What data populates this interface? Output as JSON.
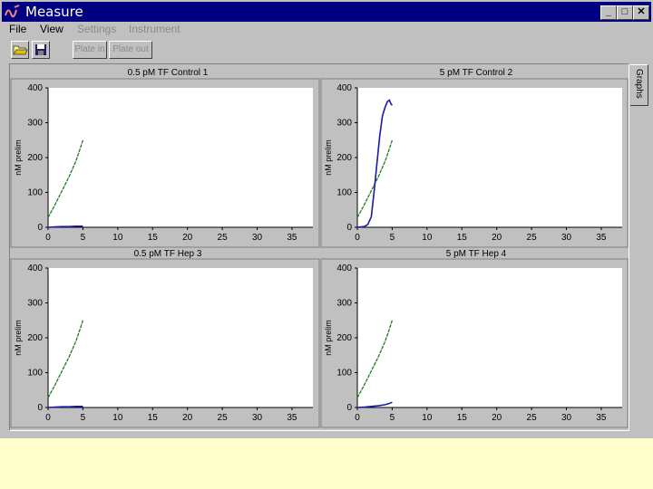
{
  "window": {
    "title": "Measure",
    "title_bar_color": "#000080",
    "controls": [
      {
        "name": "minimize-button",
        "glyph": "_"
      },
      {
        "name": "maximize-button",
        "glyph": "□"
      },
      {
        "name": "close-button",
        "glyph": "✕"
      }
    ]
  },
  "menu": {
    "items": [
      {
        "label": "File",
        "enabled": true
      },
      {
        "label": "View",
        "enabled": true
      },
      {
        "label": "Settings",
        "enabled": false
      },
      {
        "label": "Instrument",
        "enabled": false
      }
    ]
  },
  "toolbar": {
    "open_icon": "folder-open-icon",
    "save_icon": "floppy-save-icon",
    "plate_in_label": "Plate in",
    "plate_out_label": "Plate out"
  },
  "side_tab": {
    "label": "Graphs"
  },
  "colors": {
    "green_series": "#1f7a1f",
    "blue_series": "#1a1aa6",
    "background_slide": "#ffffcc"
  },
  "chart_data": [
    {
      "type": "line",
      "title": "0.5 pM TF Control 1",
      "ylabel": "nM prelim",
      "xlim": [
        0,
        38
      ],
      "ylim": [
        0,
        400
      ],
      "xticks": [
        0,
        5,
        10,
        15,
        20,
        25,
        30,
        35
      ],
      "yticks": [
        0,
        100,
        200,
        300,
        400
      ],
      "series": [
        {
          "color": "#1f7a1f",
          "x": [
            0,
            1,
            2,
            3,
            4,
            4.6,
            5
          ],
          "y": [
            28,
            65,
            105,
            145,
            190,
            225,
            250
          ]
        },
        {
          "color": "#1a1aa6",
          "x": [
            0,
            1,
            2,
            3,
            4,
            5
          ],
          "y": [
            0,
            1,
            2,
            2,
            3,
            3
          ]
        }
      ]
    },
    {
      "type": "line",
      "title": "5 pM TF Control 2",
      "ylabel": "nM prelim",
      "xlim": [
        0,
        38
      ],
      "ylim": [
        0,
        400
      ],
      "xticks": [
        0,
        5,
        10,
        15,
        20,
        25,
        30,
        35
      ],
      "yticks": [
        0,
        100,
        200,
        300,
        400
      ],
      "series": [
        {
          "color": "#1f7a1f",
          "x": [
            0,
            1,
            2,
            3,
            4,
            4.6,
            5
          ],
          "y": [
            28,
            65,
            105,
            145,
            190,
            225,
            250
          ]
        },
        {
          "color": "#1a1aa6",
          "x": [
            0,
            1,
            1.5,
            2,
            2.4,
            2.8,
            3.2,
            3.6,
            4,
            4.3,
            4.6,
            4.8,
            5
          ],
          "y": [
            0,
            2,
            8,
            30,
            100,
            180,
            260,
            320,
            345,
            360,
            365,
            355,
            350
          ]
        }
      ]
    },
    {
      "type": "line",
      "title": "0.5 pM TF Hep 3",
      "ylabel": "nM prelim",
      "xlim": [
        0,
        38
      ],
      "ylim": [
        0,
        400
      ],
      "xticks": [
        0,
        5,
        10,
        15,
        20,
        25,
        30,
        35
      ],
      "yticks": [
        0,
        100,
        200,
        300,
        400
      ],
      "series": [
        {
          "color": "#1f7a1f",
          "x": [
            0,
            1,
            2,
            3,
            4,
            4.6,
            5
          ],
          "y": [
            28,
            65,
            105,
            145,
            190,
            225,
            250
          ]
        },
        {
          "color": "#1a1aa6",
          "x": [
            0,
            1,
            2,
            3,
            4,
            5
          ],
          "y": [
            0,
            1,
            2,
            2,
            3,
            3
          ]
        }
      ]
    },
    {
      "type": "line",
      "title": "5 pM TF Hep 4",
      "ylabel": "nM prelim",
      "xlim": [
        0,
        38
      ],
      "ylim": [
        0,
        400
      ],
      "xticks": [
        0,
        5,
        10,
        15,
        20,
        25,
        30,
        35
      ],
      "yticks": [
        0,
        100,
        200,
        300,
        400
      ],
      "series": [
        {
          "color": "#1f7a1f",
          "x": [
            0,
            1,
            2,
            3,
            4,
            4.6,
            5
          ],
          "y": [
            28,
            65,
            105,
            145,
            190,
            225,
            250
          ]
        },
        {
          "color": "#1a1aa6",
          "x": [
            0,
            1,
            2,
            3,
            4,
            4.5,
            5
          ],
          "y": [
            0,
            1,
            3,
            5,
            8,
            11,
            15
          ]
        }
      ]
    }
  ]
}
